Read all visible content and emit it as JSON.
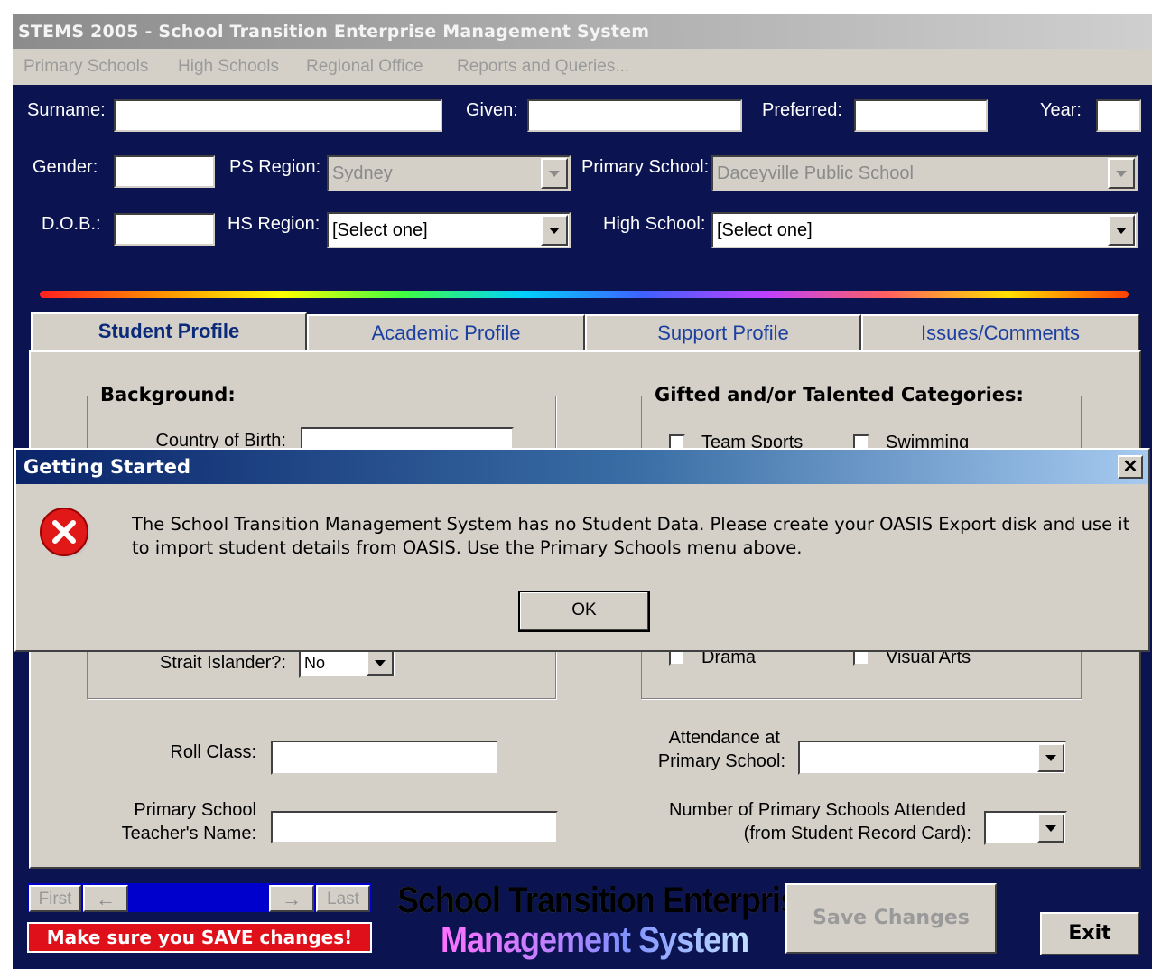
{
  "window": {
    "title": "STEMS 2005 - School Transition Enterprise Management System"
  },
  "menu": [
    "Primary Schools",
    "High Schools",
    "Regional Office",
    "Reports and Queries..."
  ],
  "header": {
    "surname_label": "Surname:",
    "given_label": "Given:",
    "preferred_label": "Preferred:",
    "year_label": "Year:",
    "gender_label": "Gender:",
    "ps_region_label": "PS Region:",
    "ps_region_value": "Sydney",
    "primary_school_label": "Primary School:",
    "primary_school_value": "Daceyville Public School",
    "dob_label": "D.O.B.:",
    "hs_region_label": "HS Region:",
    "hs_region_value": "[Select one]",
    "high_school_label": "High School:",
    "high_school_value": "[Select one]"
  },
  "tabs": [
    "Student Profile",
    "Academic Profile",
    "Support Profile",
    "Issues/Comments"
  ],
  "profile": {
    "background_title": "Background:",
    "country_label": "Country of Birth:",
    "strait_label": "Strait Islander?:",
    "strait_value": "No",
    "gifted_title": "Gifted and/or Talented Categories:",
    "gifted_items": [
      "Team Sports",
      "Swimming",
      "Drama",
      "Visual Arts"
    ],
    "roll_class_label": "Roll Class:",
    "teacher_label_1": "Primary School",
    "teacher_label_2": "Teacher's Name:",
    "attendance_label_1": "Attendance at",
    "attendance_label_2": "Primary School:",
    "num_schools_label_1": "Number of Primary Schools Attended",
    "num_schools_label_2": "(from Student Record Card):"
  },
  "nav": {
    "first": "First",
    "last": "Last",
    "back_arrow": "←",
    "forward_arrow": "→"
  },
  "banner": "Make sure you SAVE changes!",
  "logo": {
    "line1": "School Transition Enterprise",
    "line2": "Management System"
  },
  "buttons": {
    "save": "Save Changes",
    "exit": "Exit"
  },
  "dialog": {
    "title": "Getting Started",
    "message": "The School Transition Management System has no Student Data.  Please create your OASIS Export disk and use it to import student details from OASIS.  Use the Primary Schools menu above.",
    "ok": "OK",
    "close": "✕",
    "icon": "error-icon"
  }
}
